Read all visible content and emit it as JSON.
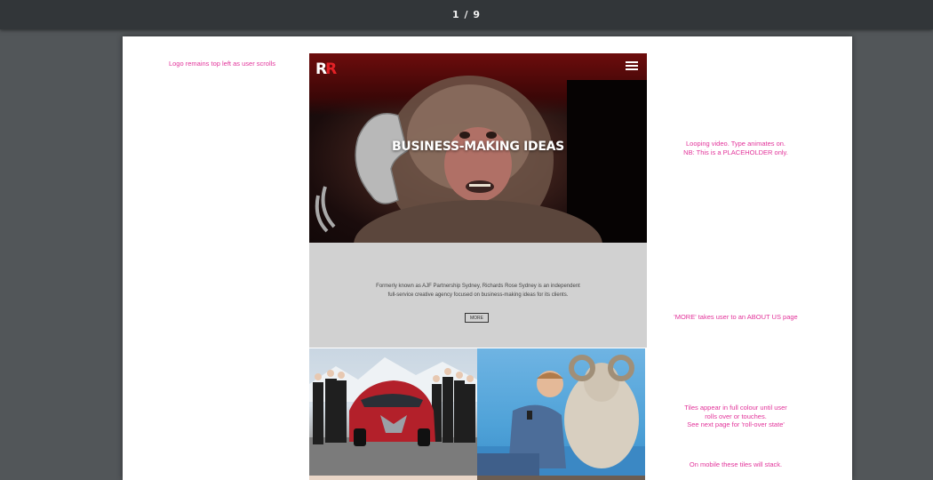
{
  "viewer": {
    "page_counter": "1 / 9"
  },
  "notes": {
    "logo": "Logo remains top left as user scrolls",
    "video": [
      "Looping video. Type animates on.",
      "NB: This is a PLACEHOLDER only."
    ],
    "more": "'MORE' takes user to an ABOUT US page",
    "tiles": [
      "Tiles appear in full colour until user",
      "rolls over or touches.",
      "See next page for 'roll-over state'"
    ],
    "mobile": "On mobile these tiles will stack."
  },
  "mockup": {
    "logo": {
      "letter1": "R",
      "letter2": "R"
    },
    "hero_title": "BUSINESS-MAKING IDEAS",
    "intro_lines": [
      "Formerly known as AJF Partnership Sydney, Richards Rose Sydney is an independent",
      "full-service creative agency focused on business-making ideas for its clients."
    ],
    "more_label": "MORE"
  },
  "colors": {
    "annotation": "#e2349a",
    "logo_red": "#e32126",
    "intro_bg": "#d1d1d1"
  }
}
